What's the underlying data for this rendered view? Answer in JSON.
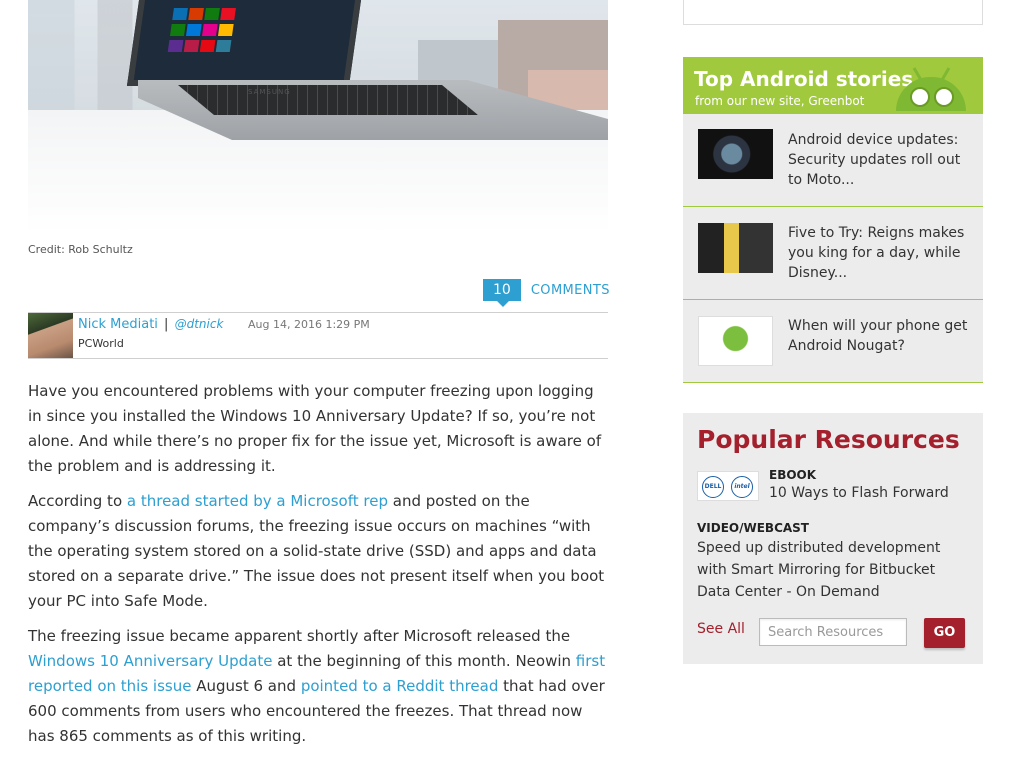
{
  "hero": {
    "brand": "SAMSUNG",
    "credit": "Credit: Rob Schultz"
  },
  "comments": {
    "count": "10",
    "label": "COMMENTS"
  },
  "author": {
    "name": "Nick Mediati",
    "separator": "|",
    "handle": "@dtnick",
    "date": "Aug 14, 2016 1:29 PM",
    "publication": "PCWorld"
  },
  "article": {
    "p1": "Have you encountered problems with your computer freezing upon logging in since you installed the Windows 10 Anniversary Update? If so, you’re not alone. And while there’s no proper fix for the issue yet, Microsoft is aware of the problem and is addressing it.",
    "p2_a": "According to ",
    "p2_link": "a thread started by a Microsoft rep",
    "p2_b": " and posted on the company’s discussion forums, the freezing issue occurs on machines “with the operating system stored on a solid-state drive (SSD) and apps and data stored on a separate drive.” The issue does not present itself when you boot your PC into Safe Mode.",
    "p3_a": "The freezing issue became apparent shortly after Microsoft released the ",
    "p3_link1": "Windows 10 Anniversary Update",
    "p3_b": " at the beginning of this month. Neowin ",
    "p3_link2": "first reported on this issue",
    "p3_c": " August 6 and ",
    "p3_link3": "pointed to a Reddit thread",
    "p3_d": " that had over 600 comments from users who encountered the freezes. That thread now has 865 comments as of this writing."
  },
  "sidebar": {
    "android": {
      "title": "Top Android stories",
      "subtitle": "from our new site, Greenbot",
      "stories": [
        {
          "title": "Android device updates: Security updates roll out to Moto..."
        },
        {
          "title": "Five to Try: Reigns makes you king for a day, while Disney..."
        },
        {
          "title": "When will your phone get Android Nougat?"
        }
      ]
    },
    "popular": {
      "title": "Popular Resources",
      "logo1": "DELL",
      "logo2": "intel",
      "ebook_label": "EBOOK",
      "ebook_title": "10 Ways to Flash Forward",
      "video_label": "VIDEO/WEBCAST",
      "video_title": "Speed up distributed development with Smart Mirroring for Bitbucket Data Center - On Demand",
      "see_all": "See All",
      "search_placeholder": "Search Resources",
      "go": "GO"
    }
  },
  "colors": {
    "link": "#2d9fd1",
    "android_green": "#a1c93d",
    "popular_red": "#a3202c"
  }
}
